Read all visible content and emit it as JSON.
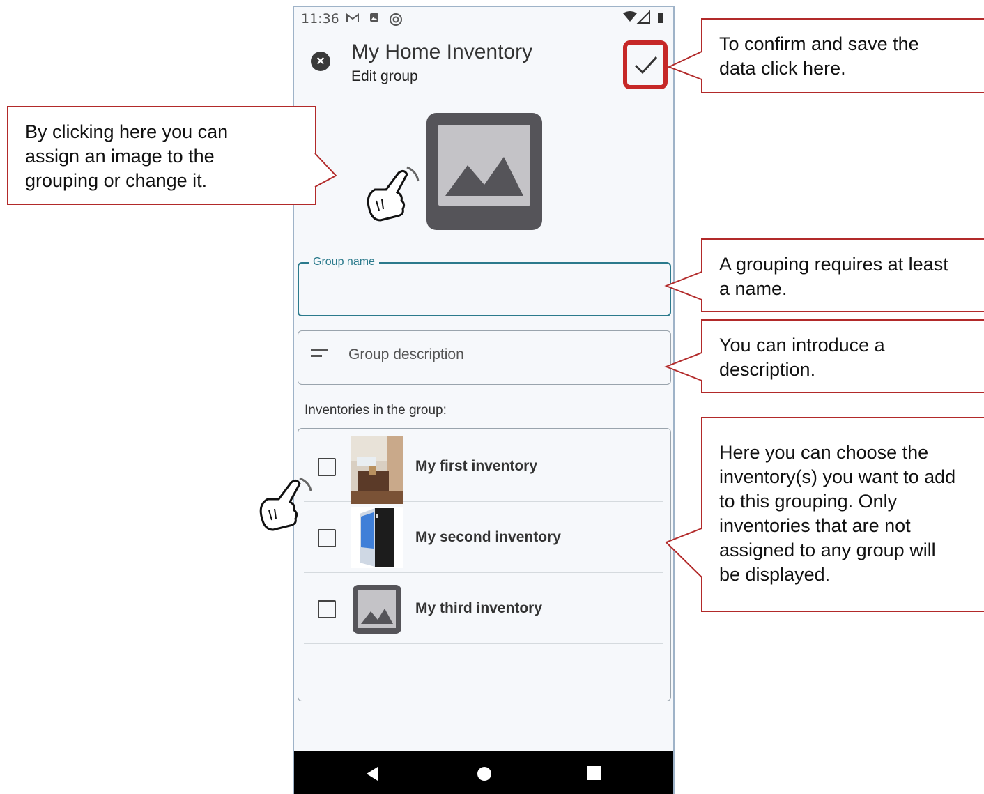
{
  "status_bar": {
    "time": "11:36"
  },
  "header": {
    "title": "My Home Inventory",
    "subtitle": "Edit group"
  },
  "form": {
    "group_name_label": "Group name",
    "group_name_value": "",
    "description_placeholder": "Group description"
  },
  "inventories": {
    "heading": "Inventories in the group:",
    "items": [
      {
        "name": "My first inventory",
        "checked": false
      },
      {
        "name": "My second inventory",
        "checked": false
      },
      {
        "name": "My third inventory",
        "checked": false
      }
    ]
  },
  "callouts": {
    "image_lines": [
      "By clicking here you can",
      "assign an image to the",
      "grouping or change it."
    ],
    "confirm_lines": [
      "To confirm and save the",
      "data click here."
    ],
    "name_lines": [
      "A grouping requires at least",
      "a name."
    ],
    "description_lines": [
      "You can introduce a",
      "description."
    ],
    "inventories_lines": [
      "Here you can choose the",
      "inventory(s) you want to add",
      "to this grouping. Only",
      "inventories that are not",
      "assigned to any group will",
      "be displayed."
    ]
  },
  "colors": {
    "accent": "#2b7a8c",
    "callout_border": "#b22a2a",
    "highlight": "#c62828"
  }
}
